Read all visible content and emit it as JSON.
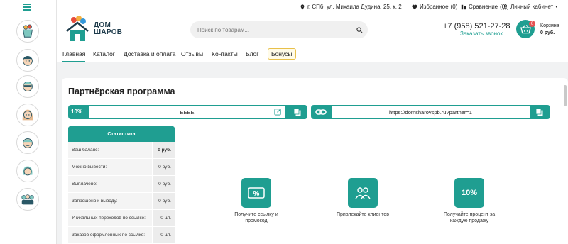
{
  "topbar": {
    "address": "г. СПб, ул. Михаила Дудина, 25, к. 2",
    "favorites": "Избранное",
    "favorites_count": "(0)",
    "compare": "Сравнение",
    "compare_count": "(0)",
    "account": "Личный кабинет"
  },
  "header": {
    "logo_line1": "ДОМ",
    "logo_line2": "ШАРОВ",
    "search_placeholder": "Поиск по товарам...",
    "phone": "+7 (958) 521-27-28",
    "callback": "Заказать звонок",
    "cart_badge": "0",
    "cart_label": "Корзина",
    "cart_sum": "0 руб."
  },
  "nav": {
    "items": [
      "Главная",
      "Каталог",
      "Доставка и оплата",
      "Отзывы",
      "Контакты",
      "Блог"
    ],
    "bonus": "Бонусы"
  },
  "page": {
    "title": "Партнёрская программа",
    "percent": "10%",
    "promo_code": "EEEE",
    "partner_link": "https://domsharovspb.ru?partner=1"
  },
  "stats": {
    "header": "Статистика",
    "rows": [
      {
        "label": "Ваш баланс:",
        "value": "0 руб."
      },
      {
        "label": "Можно вывести:",
        "value": "0 руб."
      },
      {
        "label": "Выплачено:",
        "value": "0 руб."
      },
      {
        "label": "Запрошено к выводу:",
        "value": "0 руб."
      },
      {
        "label": "Уникальных переходов по ссылке:",
        "value": "0 шт."
      },
      {
        "label": "Заказов оформленных по ссылке:",
        "value": "0 шт."
      }
    ]
  },
  "steps": [
    {
      "icon": "promo-percent-icon",
      "text1": "Получите ссылку и",
      "text2": "промокод"
    },
    {
      "icon": "clients-icon",
      "text1": "Привлекайте клиентов",
      "text2": ""
    },
    {
      "icon_text": "10%",
      "text1": "Получайте процент за",
      "text2": "каждую продажу"
    }
  ],
  "colors": {
    "accent": "#1f9e91",
    "badge": "#e55353",
    "bonus_border": "#e8c04a"
  }
}
